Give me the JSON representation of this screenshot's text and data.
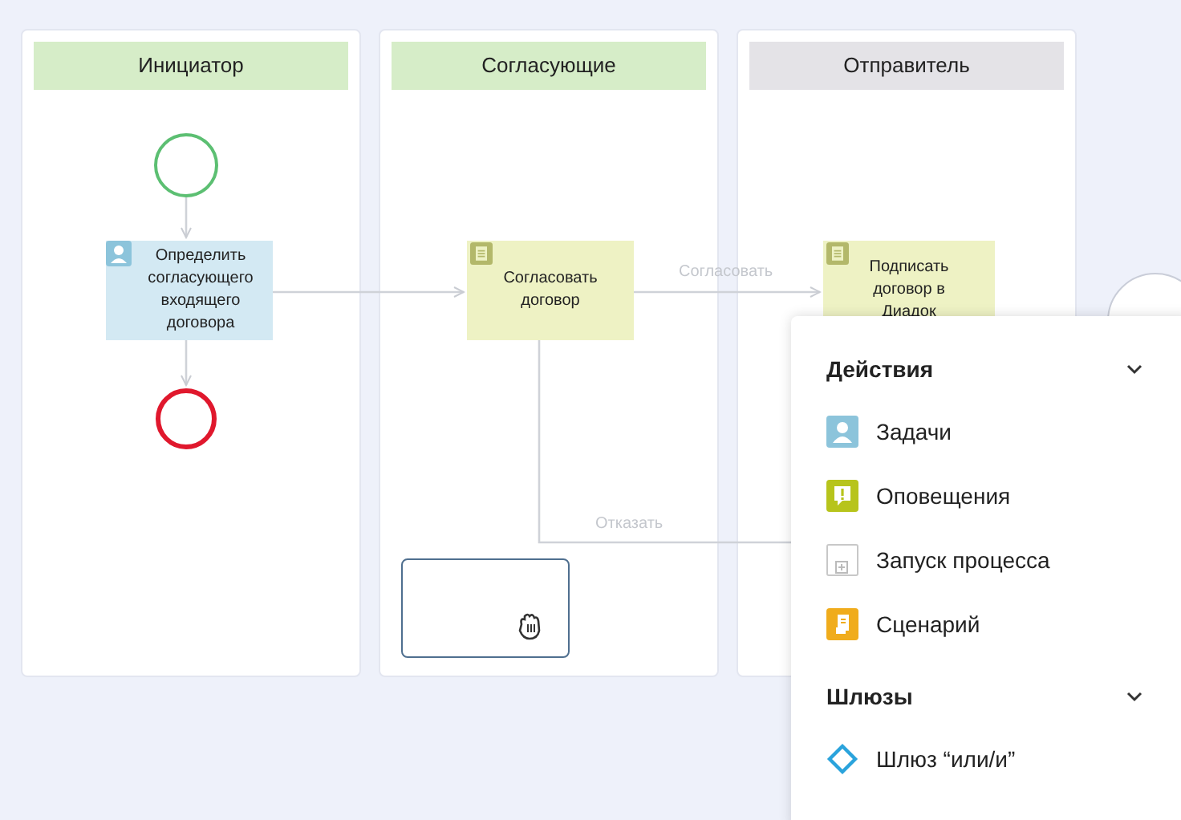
{
  "lanes": [
    {
      "title": "Инициатор",
      "kind": "participant"
    },
    {
      "title": "Согласующие",
      "kind": "participant"
    },
    {
      "title": "Отправитель",
      "kind": "system"
    }
  ],
  "nodes": [
    {
      "kind": "start"
    },
    {
      "kind": "user-task",
      "label": "Определить согласующего входящего договора"
    },
    {
      "kind": "end"
    },
    {
      "kind": "doc-task",
      "label": "Согласовать договор"
    },
    {
      "kind": "doc-task",
      "label": "Подписать договор в Диадок"
    }
  ],
  "edges": [
    {
      "kind": "flow"
    },
    {
      "kind": "flow"
    },
    {
      "kind": "flow"
    },
    {
      "kind": "flow",
      "label": "Согласовать"
    },
    {
      "kind": "flow",
      "label": "Отказать"
    }
  ],
  "palette": {
    "sections": [
      {
        "title": "Действия",
        "expanded": true,
        "items": [
          {
            "kind": "task",
            "label": "Задачи"
          },
          {
            "kind": "notification",
            "label": "Оповещения"
          },
          {
            "kind": "subprocess",
            "label": "Запуск процесса"
          },
          {
            "kind": "script",
            "label": "Сценарий"
          }
        ]
      },
      {
        "title": "Шлюзы",
        "expanded": true,
        "items": [
          {
            "kind": "gateway",
            "label": "Шлюз “или/и”"
          }
        ]
      }
    ]
  }
}
